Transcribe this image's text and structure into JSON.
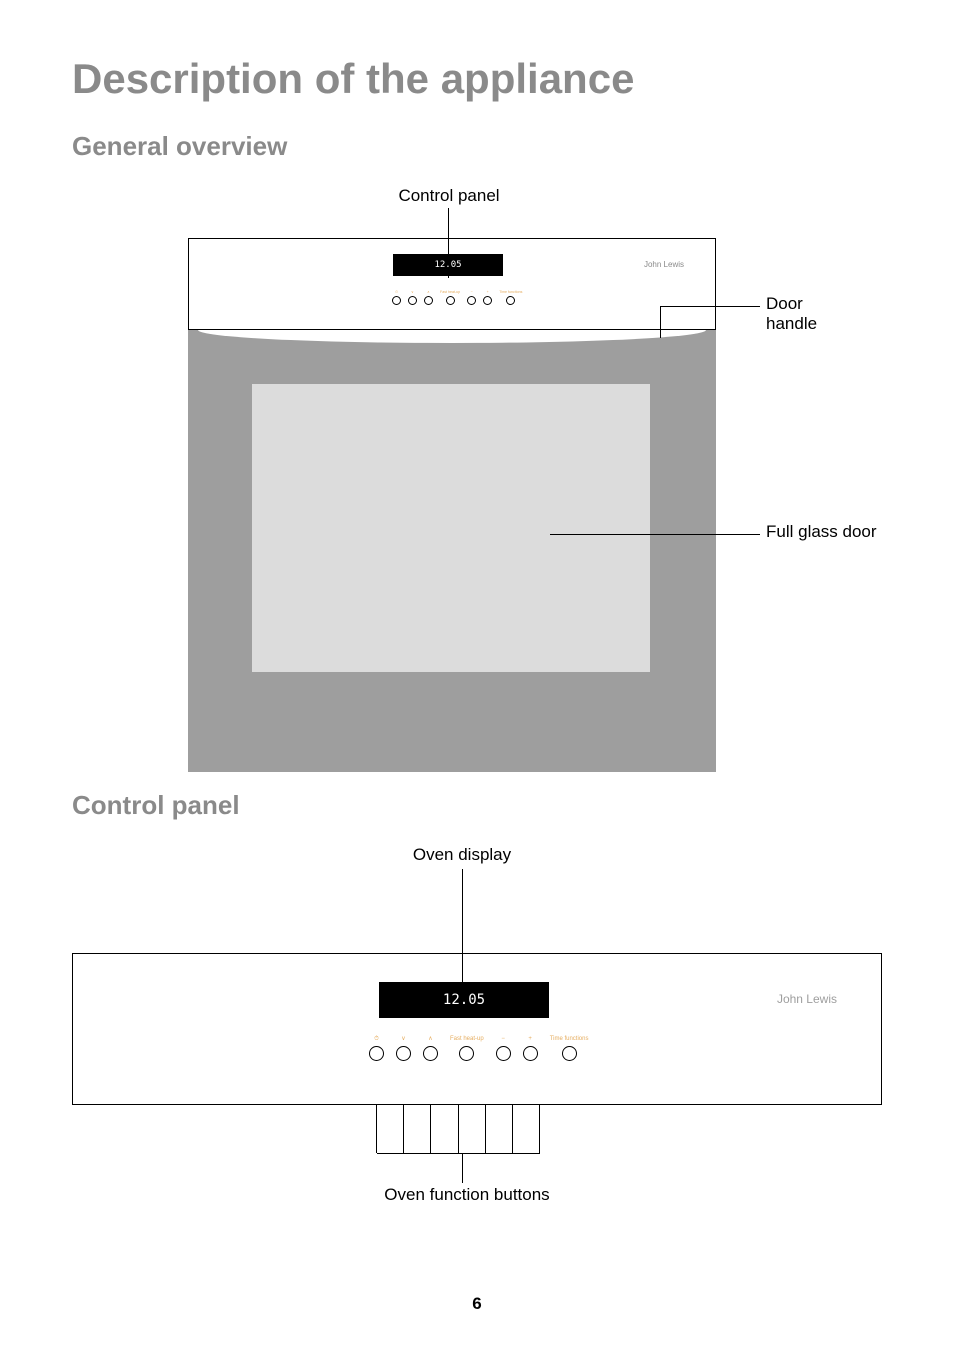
{
  "page": {
    "title": "Description of the appliance",
    "sections": {
      "general_overview": "General overview",
      "control_panel": "Control panel"
    },
    "page_number": "6"
  },
  "overview": {
    "label_control_panel": "Control panel",
    "label_door_handle_1": "Door",
    "label_door_handle_2": "handle",
    "label_full_glass": "Full glass door",
    "brand": "John Lewis",
    "display_time": "12.05",
    "buttons": [
      {
        "label": "⏱"
      },
      {
        "label": "∨"
      },
      {
        "label": "∧"
      },
      {
        "label": "Fast\nheat-up"
      },
      {
        "label": "−"
      },
      {
        "label": "+"
      },
      {
        "label": "Time\nfunctions"
      }
    ]
  },
  "control_panel": {
    "label_oven_display": "Oven display",
    "label_oven_buttons": "Oven function buttons",
    "brand": "John Lewis",
    "display_time": "12.05",
    "buttons": [
      {
        "label": "⏱"
      },
      {
        "label": "∨"
      },
      {
        "label": "∧"
      },
      {
        "label": "Fast\nheat-up"
      },
      {
        "label": "−"
      },
      {
        "label": "+"
      },
      {
        "label": "Time\nfunctions"
      }
    ]
  }
}
